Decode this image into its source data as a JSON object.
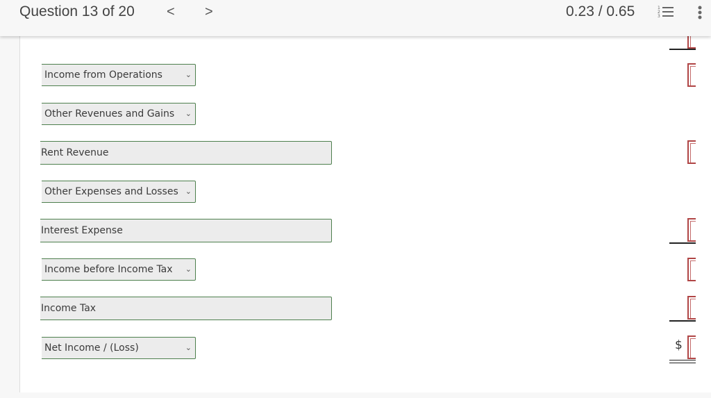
{
  "header": {
    "question_label": "Question 13 of 20",
    "prev_glyph": "<",
    "next_glyph": ">",
    "score": "0.23 / 0.65",
    "list_icon": "numbered-list-icon",
    "more_icon": "more-vertical-icon"
  },
  "rows": [
    {
      "type": "select",
      "value": "Income from Operations"
    },
    {
      "type": "select",
      "value": "Other Revenues and Gains"
    },
    {
      "type": "input",
      "value": "Rent Revenue"
    },
    {
      "type": "select",
      "value": "Other Expenses and Losses"
    },
    {
      "type": "input",
      "value": "Interest Expense"
    },
    {
      "type": "select",
      "value": "Income before Income Tax"
    },
    {
      "type": "input",
      "value": "Income Tax"
    },
    {
      "type": "select",
      "value": "Net Income / (Loss)"
    }
  ],
  "amounts": {
    "currency_symbol": "$",
    "values": [
      "",
      "",
      "",
      "",
      "",
      "",
      "",
      ""
    ]
  },
  "colors": {
    "field_border": "#4d7f4d",
    "amount_border": "#b04545"
  }
}
